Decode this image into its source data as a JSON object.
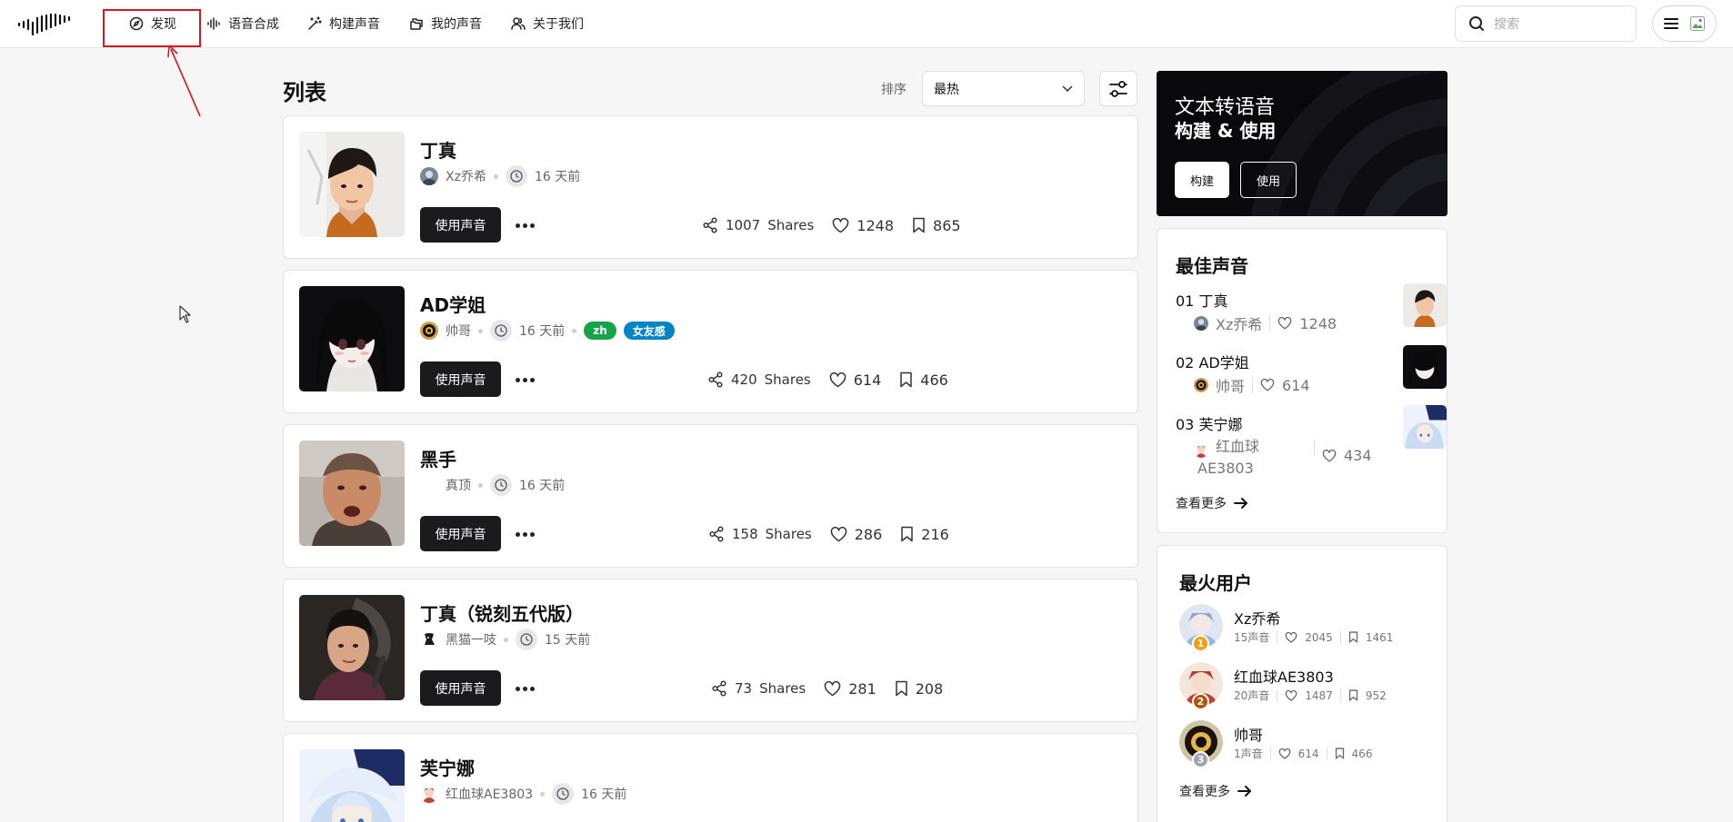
{
  "nav": {
    "items": [
      {
        "label": "发现",
        "icon": "compass-icon"
      },
      {
        "label": "语音合成",
        "icon": "audio-waveform-icon"
      },
      {
        "label": "构建声音",
        "icon": "magic-wand-icon"
      },
      {
        "label": "我的声音",
        "icon": "folders-icon"
      },
      {
        "label": "关于我们",
        "icon": "users-icon"
      }
    ],
    "search_placeholder": "搜索"
  },
  "list": {
    "title": "列表",
    "sort_label": "排序",
    "sort_value": "最热",
    "use_button": "使用声音",
    "shares_suffix": "Shares",
    "items": [
      {
        "name": "丁真",
        "author": "Xz乔希",
        "time": "16 天前",
        "tags": [],
        "shares": "1007",
        "likes": "1248",
        "saves": "865"
      },
      {
        "name": "AD学姐",
        "author": "帅哥",
        "time": "16 天前",
        "tags": [
          "zh",
          "女友感"
        ],
        "shares": "420",
        "likes": "614",
        "saves": "466"
      },
      {
        "name": "黑手",
        "author": "真顶",
        "time": "16 天前",
        "tags": [],
        "shares": "158",
        "likes": "286",
        "saves": "216"
      },
      {
        "name": "丁真（锐刻五代版）",
        "author": "黑猫一吱",
        "time": "15 天前",
        "tags": [],
        "shares": "73",
        "likes": "281",
        "saves": "208"
      },
      {
        "name": "芙宁娜",
        "author": "红血球AE3803",
        "time": "16 天前",
        "tags": [],
        "shares": "",
        "likes": "",
        "saves": ""
      }
    ]
  },
  "banner": {
    "line1": "文本转语音",
    "line2": "构建 & 使用",
    "build_button": "构建",
    "use_button": "使用"
  },
  "best_voices": {
    "title": "最佳声音",
    "items": [
      {
        "rank": "01",
        "name": "丁真",
        "author": "Xz乔希",
        "likes": "1248"
      },
      {
        "rank": "02",
        "name": "AD学姐",
        "author": "帅哥",
        "likes": "614"
      },
      {
        "rank": "03",
        "name": "芙宁娜",
        "author_line1": "红血球",
        "author_line2": "AE3803",
        "likes": "434"
      }
    ],
    "see_more": "查看更多"
  },
  "hot_users": {
    "title": "最火用户",
    "items": [
      {
        "rank": "1",
        "name": "Xz乔希",
        "voices": "15声音",
        "likes": "2045",
        "saves": "1461"
      },
      {
        "rank": "2",
        "name": "红血球AE3803",
        "voices": "20声音",
        "likes": "1487",
        "saves": "952"
      },
      {
        "rank": "3",
        "name": "帅哥",
        "voices": "1声音",
        "likes": "614",
        "saves": "466"
      }
    ],
    "see_more": "查看更多"
  },
  "colors": {
    "tag_zh": "#16a34a",
    "tag_gf": "#0284c7",
    "highlight": "#d9181e",
    "rank1": "#f59e0b",
    "rank2": "#b45309",
    "rank3": "#9ca3af"
  }
}
